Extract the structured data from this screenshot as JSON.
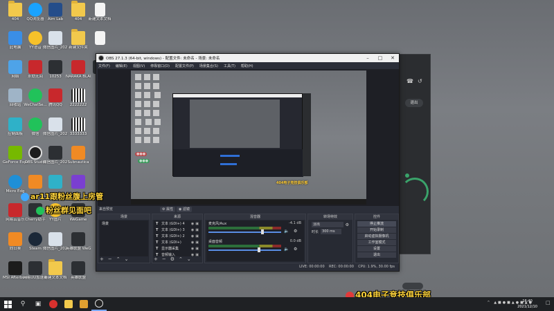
{
  "desktop": {
    "icons": [
      {
        "label": "404",
        "type": "folder",
        "icon": "folder-icon"
      },
      {
        "label": "QQ浏览器",
        "type": "qq",
        "icon": "qq-browser-icon"
      },
      {
        "label": "Aim Lab",
        "type": "aim",
        "icon": "aim-lab-icon"
      },
      {
        "label": "404",
        "type": "folder",
        "icon": "folder-icon"
      },
      {
        "label": "新建文本文档",
        "type": "file",
        "icon": "text-file-icon"
      },
      {
        "label": "此电脑",
        "type": "pc",
        "icon": "computer-icon"
      },
      {
        "label": "YY语音",
        "type": "yy",
        "icon": "yy-voice-icon"
      },
      {
        "label": "微信图片_2021102...",
        "type": "img",
        "icon": "image-file-icon"
      },
      {
        "label": "新建文件夹",
        "type": "folder",
        "icon": "folder-icon"
      },
      {
        "label": "",
        "type": "file",
        "icon": "file-icon"
      },
      {
        "label": "网络",
        "type": "net",
        "icon": "network-icon"
      },
      {
        "label": "永劫无间",
        "type": "red",
        "icon": "game-icon"
      },
      {
        "label": "10253",
        "type": "dark",
        "icon": "image-file-icon"
      },
      {
        "label": "NARAKA BLADEPOI...",
        "type": "red",
        "icon": "naraka-icon"
      },
      {
        "label": "Pea",
        "type": "dark",
        "icon": "app-icon"
      },
      {
        "label": "回收站",
        "type": "bin",
        "icon": "recycle-bin-icon"
      },
      {
        "label": "WeChatSe...",
        "type": "wechat",
        "icon": "wechat-icon"
      },
      {
        "label": "腾讯QQ",
        "type": "red",
        "icon": "qq-icon"
      },
      {
        "label": "2222222",
        "type": "qr",
        "icon": "qr-image-icon"
      },
      {
        "label": "控制面板",
        "type": "cyan",
        "icon": "control-panel-icon"
      },
      {
        "label": "微信",
        "type": "wechat",
        "icon": "wechat-icon"
      },
      {
        "label": "微信图片_2021102...",
        "type": "img",
        "icon": "image-file-icon"
      },
      {
        "label": "3333333",
        "type": "qr",
        "icon": "qr-image-icon"
      },
      {
        "label": "GeForce Experience",
        "type": "nv",
        "icon": "nvidia-icon"
      },
      {
        "label": "OBS Studio",
        "type": "obs",
        "icon": "obs-icon"
      },
      {
        "label": "微信图片_2021102...",
        "type": "dark",
        "icon": "image-file-icon"
      },
      {
        "label": "Subnautica",
        "type": "orange",
        "icon": "subnautica-icon"
      },
      {
        "label": "Micro Edg",
        "type": "edge",
        "icon": "edge-icon"
      },
      {
        "label": "",
        "type": "orange",
        "icon": "app-icon"
      },
      {
        "label": "",
        "type": "cyan",
        "icon": "app-icon"
      },
      {
        "label": "",
        "type": "purple",
        "icon": "app-icon"
      },
      {
        "label": "网易云音乐",
        "type": "red",
        "icon": "netease-music-icon"
      },
      {
        "label": "Cherry助手",
        "type": "dark",
        "icon": "cherry-icon"
      },
      {
        "label": "YY图片",
        "type": "yy",
        "icon": "image-file-icon"
      },
      {
        "label": "WeGame",
        "type": "dark",
        "icon": "wegame-icon"
      },
      {
        "label": "向日葵",
        "type": "orange",
        "icon": "sunflower-icon"
      },
      {
        "label": "Steam",
        "type": "steam",
        "icon": "steam-icon"
      },
      {
        "label": "微信图片_2021102...",
        "type": "img",
        "icon": "image-file-icon"
      },
      {
        "label": "英雄联盟 WeGame版",
        "type": "dark",
        "icon": "lol-icon"
      },
      {
        "label": "MSI Afterburner",
        "type": "msi",
        "icon": "msi-icon"
      },
      {
        "label": "网易UU加速器",
        "type": "dark",
        "icon": "uu-icon"
      },
      {
        "label": "新建文本文档",
        "type": "folder",
        "icon": "folder-icon"
      },
      {
        "label": "英雄联盟",
        "type": "dark",
        "icon": "lol-icon"
      }
    ]
  },
  "stickers": {
    "s1": "ar11跟粉丝腹上房管",
    "s2": "粉丝群见面吧",
    "s3": "404电子竞技俱乐部"
  },
  "bg_app": {
    "exit_label": "退出"
  },
  "obs": {
    "title": "OBS 27.1.3 (64-bit, windows) - 配置文件: 未命名 - 场景: 未命名",
    "menu": [
      "文件(F)",
      "编辑(E)",
      "视图(V)",
      "停靠窗口(D)",
      "配置文件(P)",
      "场景集合(S)",
      "工具(T)",
      "帮助(H)"
    ],
    "scene_label": "来自预览",
    "props_btn": "属性",
    "filter_btn": "滤镜",
    "mini_banner": "404电子竞技俱乐部",
    "docks": {
      "scenes": {
        "title": "场景",
        "items": [
          "场景"
        ]
      },
      "sources": {
        "title": "来源",
        "items": [
          {
            "type": "T",
            "name": "文本 (GDI+) 4"
          },
          {
            "type": "T",
            "name": "文本 (GDI+) 3"
          },
          {
            "type": "T",
            "name": "文本 (GDI+) 2"
          },
          {
            "type": "T",
            "name": "文本 (GDI+)"
          },
          {
            "type": "T",
            "name": "显示器采集"
          },
          {
            "type": "T",
            "name": "音频输入"
          }
        ]
      },
      "mixer": {
        "title": "混音器",
        "channels": [
          {
            "name": "麦克风/Aux",
            "db": "-4.1 dB",
            "level": 0.72
          },
          {
            "name": "桌面音频",
            "db": "0.0 dB",
            "level": 0.68
          }
        ]
      },
      "transitions": {
        "title": "转场特效",
        "type": "淡出",
        "duration_label": "时长",
        "duration": "300 ms"
      },
      "controls": {
        "title": "控件",
        "buttons": [
          "停止推流",
          "开始录制",
          "启动虚拟摄像机",
          "工作室模式",
          "设置",
          "退出"
        ]
      }
    },
    "status": "LIVE: 00:00:00    REC: 00:00:00    CPU: 1.9%, 30.00 fps"
  },
  "taskbar": {
    "time": "16:40",
    "date": "2021/12/10"
  }
}
